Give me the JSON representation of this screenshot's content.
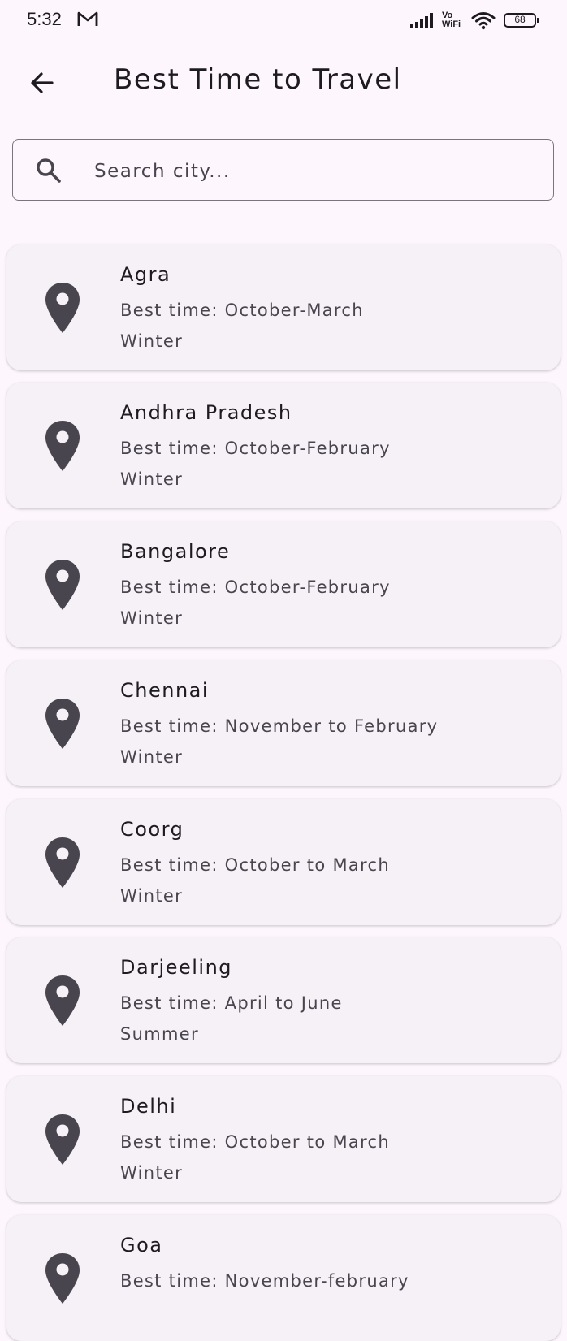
{
  "status_bar": {
    "time": "5:32",
    "network_label_top": "Vo",
    "network_label_bottom": "WiFi",
    "battery": "68",
    "icons": [
      "gmail-icon",
      "signal-icon",
      "wifi-icon",
      "battery-icon"
    ]
  },
  "header": {
    "title": "Best Time to Travel",
    "back_icon": "arrow-left-icon"
  },
  "search": {
    "placeholder": "Search city...",
    "value": "",
    "icon": "search-icon"
  },
  "colors": {
    "background": "#fdf7fd",
    "card": "#f6f1f7",
    "pin": "#49454f",
    "outline": "#79747e"
  },
  "cities": [
    {
      "name": "Agra",
      "best_time": "Best time: October-March",
      "season": "Winter"
    },
    {
      "name": "Andhra Pradesh",
      "best_time": "Best time: October-February",
      "season": "Winter"
    },
    {
      "name": "Bangalore",
      "best_time": "Best time: October-February",
      "season": "Winter"
    },
    {
      "name": "Chennai",
      "best_time": "Best time: November to February",
      "season": "Winter"
    },
    {
      "name": "Coorg",
      "best_time": "Best time: October to March",
      "season": "Winter"
    },
    {
      "name": "Darjeeling",
      "best_time": "Best time: April to June",
      "season": "Summer"
    },
    {
      "name": "Delhi",
      "best_time": "Best time: October to March",
      "season": "Winter"
    },
    {
      "name": "Goa",
      "best_time": "Best time: November-february",
      "season": ""
    }
  ]
}
